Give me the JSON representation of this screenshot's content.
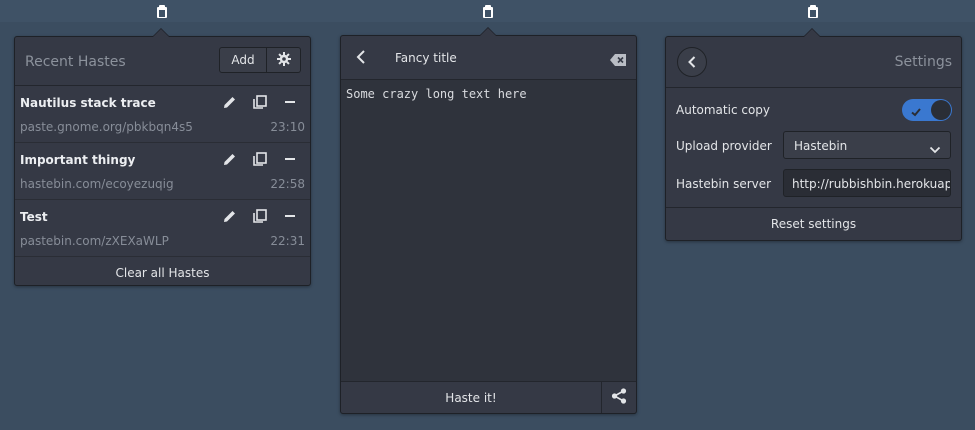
{
  "recent": {
    "title": "Recent Hastes",
    "add_label": "Add",
    "items": [
      {
        "title": "Nautilus stack trace",
        "url": "paste.gnome.org/pbkbqn4s5",
        "time": "23:10"
      },
      {
        "title": "Important thingy",
        "url": "hastebin.com/ecoyezuqig",
        "time": "22:58"
      },
      {
        "title": "Test",
        "url": "pastebin.com/zXEXaWLP",
        "time": "22:31"
      }
    ],
    "clear_label": "Clear all Hastes"
  },
  "editor": {
    "title": "Fancy title",
    "content": "Some crazy long text here",
    "haste_label": "Haste it!"
  },
  "settings": {
    "title": "Settings",
    "auto_copy_label": "Automatic copy",
    "auto_copy_enabled": true,
    "upload_provider_label": "Upload provider",
    "upload_provider_value": "Hastebin",
    "server_label": "Hastebin server",
    "server_value": "http://rubbishbin.herokuapp.com",
    "reset_label": "Reset settings"
  },
  "colors": {
    "desktop_bg": "#3b4d60",
    "popover_bg": "#353945",
    "accent": "#3a78d0"
  },
  "icons": [
    "clipboard-icon",
    "gear-icon",
    "edit-icon",
    "copy-icon",
    "remove-icon",
    "back-icon",
    "clear-text-icon",
    "share-icon",
    "check-icon",
    "chevron-down-icon"
  ]
}
